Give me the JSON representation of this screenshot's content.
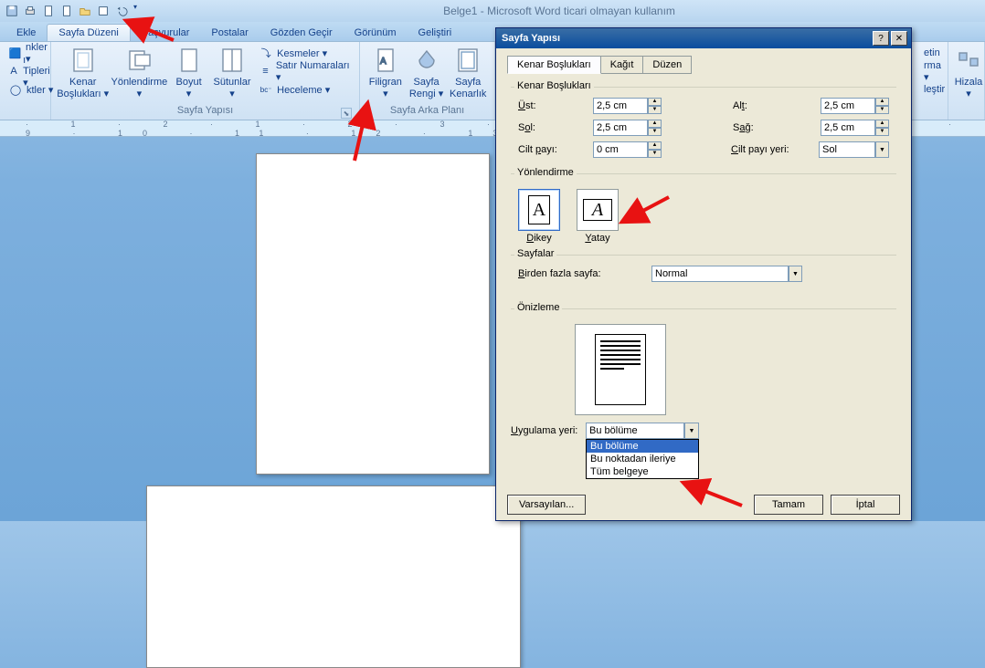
{
  "window": {
    "title": "Belge1 - Microsoft Word ticari olmayan kullanım"
  },
  "tabs": {
    "ekle": "Ekle",
    "sayfa_duzeni": "Sayfa Düzeni",
    "basvurular": "Başvurular",
    "postalar": "Postalar",
    "gozden_gecir": "Gözden Geçir",
    "gorunum": "Görünüm",
    "gelistiri": "Geliştiri"
  },
  "ribbon": {
    "grp_temalar": {
      "nkler": "nkler ▾",
      "tipleri": "ı Tipleri ▾",
      "ktler": "ktler ▾"
    },
    "grp_sayfa_yapisi": {
      "kenar_bosluklari": "Kenar\nBoşlukları ▾",
      "yonlendirme": "Yönlendirme\n▾",
      "boyut": "Boyut\n▾",
      "sutunlar": "Sütunlar\n▾",
      "kesmeler": "Kesmeler ▾",
      "satir_no": "Satır Numaraları ▾",
      "heceleme": "Heceleme ▾",
      "label": "Sayfa Yapısı"
    },
    "grp_arka": {
      "filigran": "Filigran\n▾",
      "sayfa_rengi": "Sayfa\nRengi ▾",
      "sayfa_kenarlik": "Sayfa\nKenarlık",
      "label": "Sayfa Arka Planı"
    },
    "grp_right": {
      "etin": "etin",
      "rma": "rma ▾",
      "lestir": "leştir",
      "hizala": "Hizala\n▾"
    }
  },
  "ruler": {
    "text": "1 2 1 2 3 4 5 6 7 8 9 10 11 12 13 14 15  "
  },
  "dialog": {
    "title": "Sayfa Yapısı",
    "tabs": {
      "kenar": "Kenar Boşlukları",
      "kagit": "Kağıt",
      "duzen": "Düzen"
    },
    "margins": {
      "legend": "Kenar Boşlukları",
      "ust": "Üst:",
      "ust_v": "2,5 cm",
      "alt": "Alt:",
      "alt_v": "2,5 cm",
      "sol": "Sol:",
      "sol_v": "2,5 cm",
      "sag": "Sağ:",
      "sag_v": "2,5 cm",
      "cilt": "Cilt payı:",
      "cilt_v": "0 cm",
      "cilt_yeri": "Cilt payı yeri:",
      "cilt_yeri_v": "Sol"
    },
    "orient": {
      "legend": "Yönlendirme",
      "dikey": "Dikey",
      "yatay": "Yatay"
    },
    "sayfalar": {
      "legend": "Sayfalar",
      "birden": "Birden fazla sayfa:",
      "value": "Normal"
    },
    "onizleme": {
      "legend": "Önizleme"
    },
    "apply": {
      "label": "Uygulama yeri:",
      "value": "Bu bölüme",
      "opts": [
        "Bu bölüme",
        "Bu noktadan ileriye",
        "Tüm belgeye"
      ]
    },
    "buttons": {
      "varsayilan": "Varsayılan...",
      "tamam": "Tamam",
      "iptal": "İptal"
    }
  }
}
